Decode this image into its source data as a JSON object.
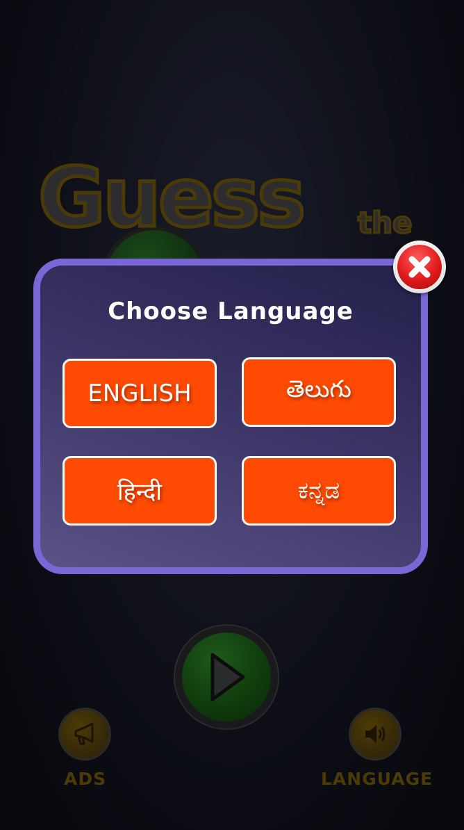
{
  "background": {
    "logo_word": "Guess",
    "logo_the": "the",
    "bottom_left_label": "ADS",
    "bottom_right_label": "LANGUAGE",
    "icons": {
      "play": "play-icon",
      "ads": "megaphone-icon",
      "language": "speaker-icon"
    }
  },
  "dialog": {
    "title": "Choose Language",
    "close_icon": "close-icon",
    "languages": [
      {
        "id": "english",
        "label": "ENGLISH"
      },
      {
        "id": "telugu",
        "label": "తెలుగు"
      },
      {
        "id": "hindi",
        "label": "हिन्दी"
      },
      {
        "id": "kannada",
        "label": "ಕನ್ನಡ"
      }
    ]
  },
  "colors": {
    "dialog_border": "#7b66d6",
    "button_fill": "#fe4a03",
    "button_border": "#ffffff",
    "close_red": "#e01a1a",
    "background": "#0d0e16"
  }
}
